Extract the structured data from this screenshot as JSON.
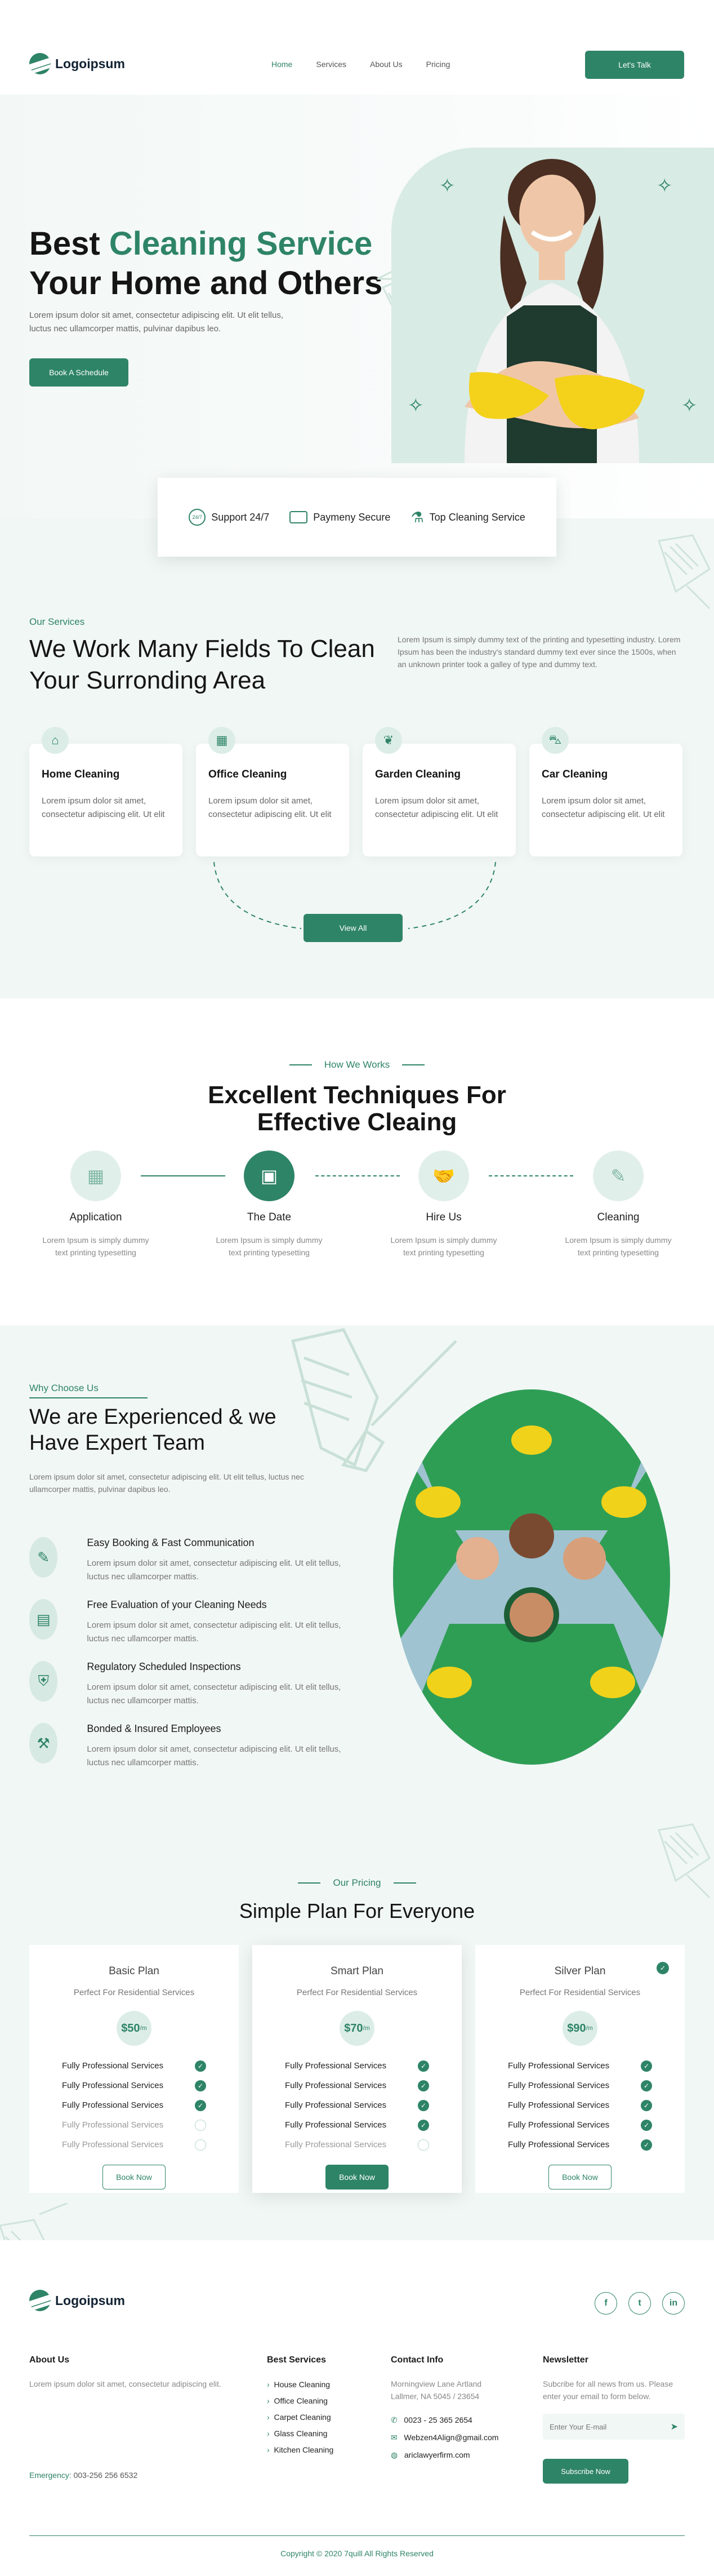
{
  "colors": {
    "accent": "#2e8466",
    "light_bg": "#f1f7f5",
    "soft_green": "#dcede7"
  },
  "header": {
    "brand": "Logoipsum",
    "nav": [
      "Home",
      "Services",
      "About Us",
      "Pricing"
    ],
    "cta": "Let's Talk"
  },
  "hero": {
    "title_1": "Best ",
    "title_accent": "Cleaning Service",
    "title_2": "Your Home and Others",
    "text": "Lorem ipsum dolor sit amet, consectetur adipiscing elit. Ut elit tellus, luctus nec ullamcorper mattis, pulvinar dapibus leo.",
    "button": "Book A Schedule"
  },
  "features_bar": [
    "Support 24/7",
    "Paymeny Secure",
    "Top Cleaning Service"
  ],
  "services": {
    "eyebrow": "Our Services",
    "title": "We Work Many Fields To Clean Your Surronding Area",
    "text": "Lorem Ipsum is simply dummy text of the printing and typesetting industry. Lorem Ipsum has been the industry's standard dummy text ever since the 1500s, when an unknown printer took a galley of type and dummy text.",
    "cards": [
      {
        "title": "Home Cleaning",
        "text": "Lorem ipsum dolor sit amet, consectetur adipiscing elit. Ut elit",
        "icon": "house-icon"
      },
      {
        "title": "Office Cleaning",
        "text": "Lorem ipsum dolor sit amet, consectetur adipiscing elit. Ut elit",
        "icon": "building-icon"
      },
      {
        "title": "Garden Cleaning",
        "text": "Lorem ipsum dolor sit amet, consectetur adipiscing elit. Ut elit",
        "icon": "leaf-icon"
      },
      {
        "title": "Car Cleaning",
        "text": "Lorem ipsum dolor sit amet, consectetur adipiscing elit. Ut elit",
        "icon": "car-icon"
      }
    ],
    "button": "View All"
  },
  "how": {
    "eyebrow": "How We Works",
    "title_1": "Excellent Techniques For",
    "title_2": "Effective Cleaing",
    "steps": [
      {
        "title": "Application",
        "text": "Lorem Ipsum is simply dummy text printing typesetting",
        "icon": "grid-icon"
      },
      {
        "title": "The Date",
        "text": "Lorem Ipsum is simply dummy text printing typesetting",
        "icon": "calendar-icon"
      },
      {
        "title": "Hire Us",
        "text": "Lorem Ipsum is simply dummy text printing typesetting",
        "icon": "handshake-icon"
      },
      {
        "title": "Cleaning",
        "text": "Lorem Ipsum is simply dummy text printing typesetting",
        "icon": "broom-icon"
      }
    ]
  },
  "why": {
    "eyebrow": "Why Choose Us",
    "title": "We are Experienced & we Have Expert Team",
    "text": "Lorem ipsum dolor sit amet, consectetur adipiscing elit. Ut elit tellus, luctus nec ullamcorper mattis, pulvinar dapibus leo.",
    "items": [
      {
        "title": "Easy Booking & Fast Communication",
        "text": "Lorem ipsum dolor sit amet, consectetur adipiscing elit. Ut elit tellus, luctus nec ullamcorper mattis.",
        "icon": "edit-icon"
      },
      {
        "title": "Free Evaluation of your Cleaning Needs",
        "text": "Lorem ipsum dolor sit amet, consectetur adipiscing elit. Ut elit tellus, luctus nec ullamcorper mattis.",
        "icon": "clipboard-icon"
      },
      {
        "title": "Regulatory Scheduled Inspections",
        "text": "Lorem ipsum dolor sit amet, consectetur adipiscing elit. Ut elit tellus, luctus nec ullamcorper mattis.",
        "icon": "shield-icon"
      },
      {
        "title": "Bonded & Insured Employees",
        "text": "Lorem ipsum dolor sit amet, consectetur adipiscing elit. Ut elit tellus, luctus nec ullamcorper mattis.",
        "icon": "tools-icon"
      }
    ]
  },
  "pricing": {
    "eyebrow": "Our Pricing",
    "title": "Simple Plan For Everyone",
    "plans": [
      {
        "name": "Basic Plan",
        "sub": "Perfect For Residential Services",
        "price": "$50",
        "unit": "/m",
        "features": [
          {
            "label": "Fully Professional Services",
            "included": true
          },
          {
            "label": "Fully Professional Services",
            "included": true
          },
          {
            "label": "Fully Professional Services",
            "included": true
          },
          {
            "label": "Fully Professional Services",
            "included": false
          },
          {
            "label": "Fully Professional Services",
            "included": false
          }
        ],
        "button": "Book Now"
      },
      {
        "name": "Smart Plan",
        "sub": "Perfect For Residential Services",
        "price": "$70",
        "unit": "/m",
        "features": [
          {
            "label": "Fully Professional Services",
            "included": true
          },
          {
            "label": "Fully Professional Services",
            "included": true
          },
          {
            "label": "Fully Professional Services",
            "included": true
          },
          {
            "label": "Fully Professional Services",
            "included": true
          },
          {
            "label": "Fully Professional Services",
            "included": false
          }
        ],
        "button": "Book Now"
      },
      {
        "name": "Silver Plan",
        "sub": "Perfect For Residential Services",
        "price": "$90",
        "unit": "/m",
        "features": [
          {
            "label": "Fully Professional Services",
            "included": true
          },
          {
            "label": "Fully Professional Services",
            "included": true
          },
          {
            "label": "Fully Professional Services",
            "included": true
          },
          {
            "label": "Fully Professional Services",
            "included": true
          },
          {
            "label": "Fully Professional Services",
            "included": true
          }
        ],
        "button": "Book Now"
      }
    ]
  },
  "footer": {
    "brand": "Logoipsum",
    "socials": [
      "f",
      "t",
      "in"
    ],
    "about_title": "About Us",
    "about_text": "Lorem ipsum dolor sit amet, consectetur adipiscing elit.",
    "emergency_label": "Emergency:",
    "emergency_phone": "003-256 256 6532",
    "services_title": "Best Services",
    "services": [
      "House Cleaning",
      "Office Cleaning",
      "Carpet Cleaning",
      "Glass Cleaning",
      "Kitchen Cleaning"
    ],
    "contact_title": "Contact Info",
    "address": "Morningview Lane Artland Lallmer, NA 5045 / 23654",
    "phone": "0023 - 25 365 2654",
    "email": "Webzen4Align@gmail.com",
    "website": "ariclawyerfirm.com",
    "newsletter_title": "Newsletter",
    "newsletter_text": "Subcribe for all news from us. Please enter your email to form below.",
    "newsletter_placeholder": "Enter Your E-mail",
    "newsletter_button": "Subscribe Now",
    "copyright": "Copyright © 2020 7quill All Rights Reserved"
  }
}
